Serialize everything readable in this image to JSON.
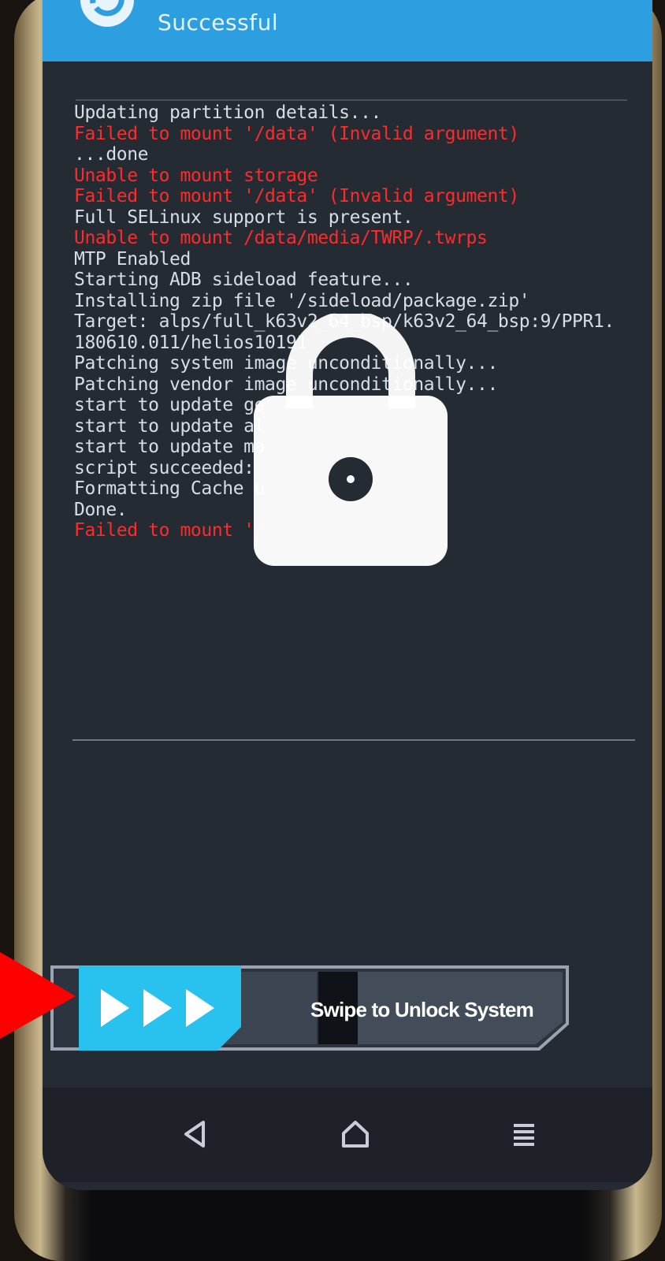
{
  "header": {
    "title": "Successful"
  },
  "console": {
    "lines": [
      {
        "text": "Updating partition details...",
        "type": "normal"
      },
      {
        "text": "Failed to mount '/data' (Invalid argument)",
        "type": "error"
      },
      {
        "text": "...done",
        "type": "normal"
      },
      {
        "text": "Unable to mount storage",
        "type": "error"
      },
      {
        "text": "Failed to mount '/data' (Invalid argument)",
        "type": "error"
      },
      {
        "text": "Full SELinux support is present.",
        "type": "normal"
      },
      {
        "text": "Unable to mount /data/media/TWRP/.twrps",
        "type": "error"
      },
      {
        "text": "MTP Enabled",
        "type": "normal"
      },
      {
        "text": "Starting ADB sideload feature...",
        "type": "normal"
      },
      {
        "text": "Installing zip file '/sideload/package.zip'",
        "type": "normal"
      },
      {
        "text": "Target: alps/full_k63v2_64_bsp/k63v2_64_bsp:9/PPR1.",
        "type": "normal"
      },
      {
        "text": "180610.011/helios10191",
        "type": "normal"
      },
      {
        "text": "Patching system image unconditionally...",
        "type": "normal"
      },
      {
        "text": "Patching vendor image unconditionally...",
        "type": "normal"
      },
      {
        "text": "start to update ge",
        "type": "normal"
      },
      {
        "text": "start to update al",
        "type": "normal"
      },
      {
        "text": "start to update ma",
        "type": "normal"
      },
      {
        "text": "script succeeded:",
        "type": "normal"
      },
      {
        "text": "Formatting Cache u",
        "type": "normal"
      },
      {
        "text": "Done.",
        "type": "normal"
      },
      {
        "text": "Failed to mount '/",
        "type": "error"
      }
    ]
  },
  "slider": {
    "label": "Swipe to Unlock System"
  },
  "colors": {
    "header_bg": "#2d9fe0",
    "console_bg": "#252b33",
    "console_text": "#d7dde6",
    "console_error": "#ff2b2b",
    "slider_accent": "#29c2ee"
  },
  "icons": {
    "header": "refresh-icon",
    "lock": "lock-icon",
    "slider_handle": "triple-chevron-right-icon",
    "nav_back": "back-triangle-icon",
    "nav_home": "home-icon",
    "nav_menu": "menu-icon",
    "annotation": "red-arrow-icon"
  }
}
